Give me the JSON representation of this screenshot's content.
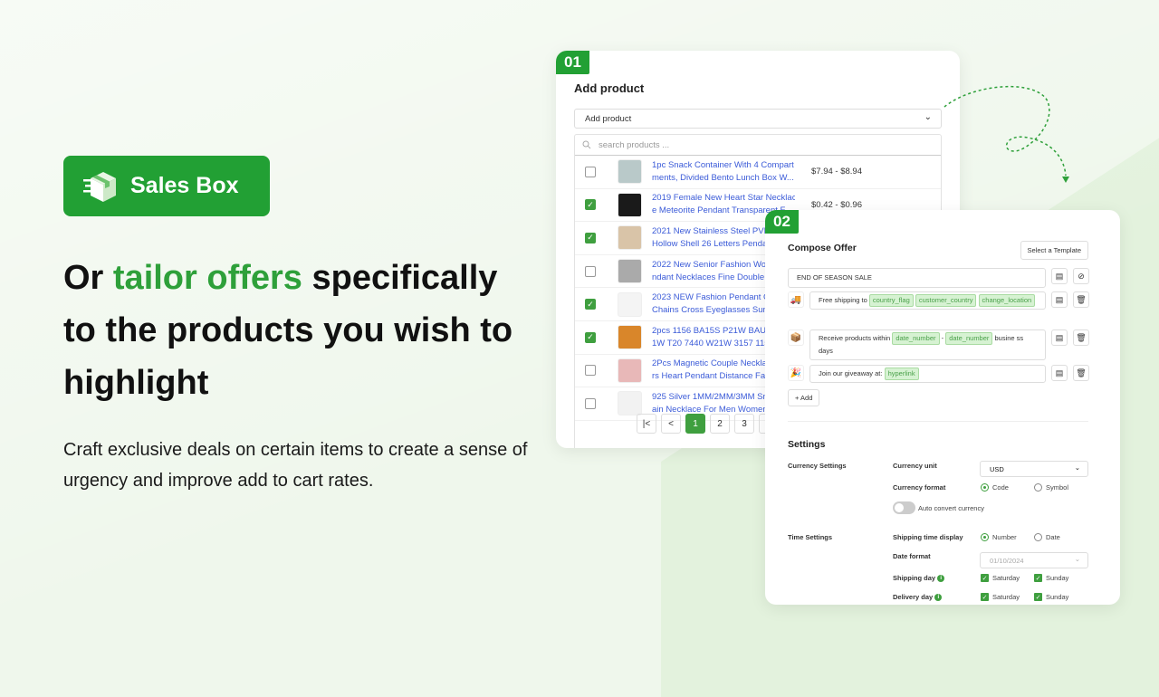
{
  "brand": {
    "name": "Sales Box",
    "color": "#22a034"
  },
  "headline": {
    "pre": "Or ",
    "highlight": "tailor offers",
    "post": " specifically to the products you wish to highlight"
  },
  "subtext": "Craft exclusive deals on certain items to create a sense of urgency and improve add to cart rates.",
  "step1": {
    "badge": "01",
    "title": "Add product",
    "select_value": "Add product",
    "search_placeholder": "search products ...",
    "products": [
      {
        "name1": "1pc Snack Container With 4 Compart",
        "name2": "ments, Divided Bento Lunch Box W...",
        "price": "$7.94 - $8.94",
        "checked": false,
        "thumb": "#b9c9c9"
      },
      {
        "name1": "2019 Female New Heart Star Necklac",
        "name2": "e Meteorite Pendant Transparent F...",
        "price": "$0.42 - $0.96",
        "checked": true,
        "thumb": "#1a1a1a"
      },
      {
        "name1": "2021 New Stainless Steel PVD Pla",
        "name2": "Hollow Shell 26 Letters Pendant",
        "price": "",
        "checked": true,
        "thumb": "#d9c4a8"
      },
      {
        "name1": "2022 New Senior Fashion Wome",
        "name2": "ndant Necklaces Fine Double Lin",
        "price": "",
        "checked": false,
        "thumb": "#aaaaaa"
      },
      {
        "name1": "2023 NEW Fashion Pendant Glas",
        "name2": "Chains Cross Eyeglasses Sunglas",
        "price": "",
        "checked": true,
        "thumb": "#f4f4f4"
      },
      {
        "name1": "2pcs 1156 BA15S P21W BAU15S",
        "name2": "1W T20 7440 W21W 3157 1157 P",
        "price": "",
        "checked": true,
        "thumb": "#d9862a"
      },
      {
        "name1": "2Pcs Magnetic Couple Necklace",
        "name2": "rs Heart Pendant Distance Facet",
        "price": "",
        "checked": false,
        "thumb": "#e8b8b8"
      },
      {
        "name1": "925 Silver 1MM/2MM/3MM Snak",
        "name2": "ain Necklace For Men Women Sil",
        "price": "",
        "checked": false,
        "thumb": "#f2f2f2"
      }
    ],
    "pages": [
      "1",
      "2",
      "3",
      "4"
    ],
    "current_page": "1"
  },
  "step2": {
    "badge": "02",
    "title": "Compose Offer",
    "template_button": "Select a Template",
    "headline_field": "END OF SEASON SALE",
    "lines": [
      {
        "icon": "truck",
        "emoji": "🚚",
        "text": "Free shipping to",
        "tags": [
          "country_flag",
          "customer_country",
          "change_location"
        ]
      },
      {
        "icon": "box",
        "emoji": "📦",
        "text": "Receive products within",
        "tags": [
          "date_number",
          "date_number"
        ],
        "sep": "-",
        "tail": "busine ss days"
      },
      {
        "icon": "party",
        "emoji": "🎉",
        "text": "Join our giveaway at:",
        "tags": [
          "hyperlink"
        ]
      }
    ],
    "add_button": "+ Add",
    "settings": {
      "title": "Settings",
      "currency_section": "Currency Settings",
      "currency_unit_label": "Currency unit",
      "currency_unit": "USD",
      "currency_format_label": "Currency format",
      "format_options": [
        "Code",
        "Symbol"
      ],
      "format_selected": "Code",
      "auto_convert": "Auto convert currency",
      "auto_convert_on": false,
      "time_section": "Time Settings",
      "shipping_display_label": "Shipping time display",
      "display_options": [
        "Number",
        "Date"
      ],
      "display_selected": "Number",
      "date_format_label": "Date format",
      "date_format": "01/10/2024",
      "shipping_day_label": "Shipping day",
      "delivery_day_label": "Delivery day",
      "days": [
        "Saturday",
        "Sunday"
      ]
    }
  }
}
